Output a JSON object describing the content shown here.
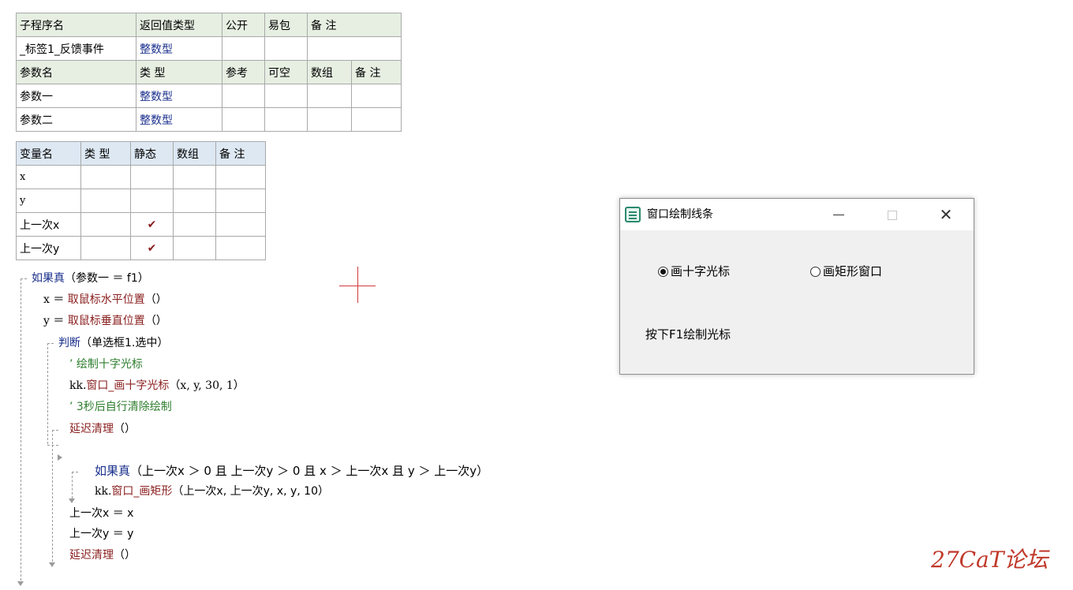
{
  "sub_table": {
    "headers": [
      "子程序名",
      "返回值类型",
      "公开",
      "易包",
      "备 注"
    ],
    "row": [
      "_标签1_反馈事件",
      "整数型",
      "",
      "",
      ""
    ],
    "param_headers": [
      "参数名",
      "类 型",
      "参考",
      "可空",
      "数组",
      "备 注"
    ],
    "params": [
      [
        "参数一",
        "整数型",
        "",
        "",
        "",
        ""
      ],
      [
        "参数二",
        "整数型",
        "",
        "",
        "",
        ""
      ]
    ]
  },
  "var_table": {
    "headers": [
      "变量名",
      "类 型",
      "静态",
      "数组",
      "备 注"
    ],
    "rows": [
      [
        "x",
        "",
        "",
        "",
        ""
      ],
      [
        "y",
        "",
        "",
        "",
        ""
      ],
      [
        "上一次x",
        "",
        "✔",
        "",
        ""
      ],
      [
        "上一次y",
        "",
        "✔",
        "",
        ""
      ]
    ]
  },
  "code": {
    "l1_kw": "如果真",
    "l1_rest": "（参数一 ＝ f1）",
    "l2_var": "x ＝ ",
    "l2_fn": "取鼠标水平位置",
    "l2_rest": "（）",
    "l3_var": "y ＝ ",
    "l3_fn": "取鼠标垂直位置",
    "l3_rest": "（）",
    "l4_kw": "判断",
    "l4_rest": "（单选框1.选中）",
    "l5_comment": "’ 绘制十字光标",
    "l6_obj": "kk.",
    "l6_fn": "窗口_画十字光标",
    "l6_rest": "（x, y, 30, 1）",
    "l7_comment": "’ 3秒后自行清除绘制",
    "l8_fn": "延迟清理",
    "l8_rest": "（）",
    "l9_kw": "如果真",
    "l9_rest": "（上一次x ＞ 0 且 上一次y ＞ 0 且 x ＞ 上一次x 且 y ＞ 上一次y）",
    "l10_obj": "kk.",
    "l10_fn": "窗口_画矩形",
    "l10_rest": "（上一次x, 上一次y, x, y, 10）",
    "l11": "上一次x ＝ x",
    "l12": "上一次y ＝ y",
    "l13_fn": "延迟清理",
    "l13_rest": "（）"
  },
  "window": {
    "title": "窗口绘制线条",
    "radio1": "画十字光标",
    "radio2": "画矩形窗口",
    "radio1_selected": true,
    "hint": "按下F1绘制光标",
    "close_glyph": "✕"
  },
  "watermark": "27CaT论坛",
  "colors": {
    "keyword": "#1a2f8c",
    "function": "#8a1e1e",
    "comment": "#2e7d2e",
    "header_green": "#e6efe2",
    "header_blue": "#dde8f3",
    "crosshair": "#d23a3a"
  }
}
